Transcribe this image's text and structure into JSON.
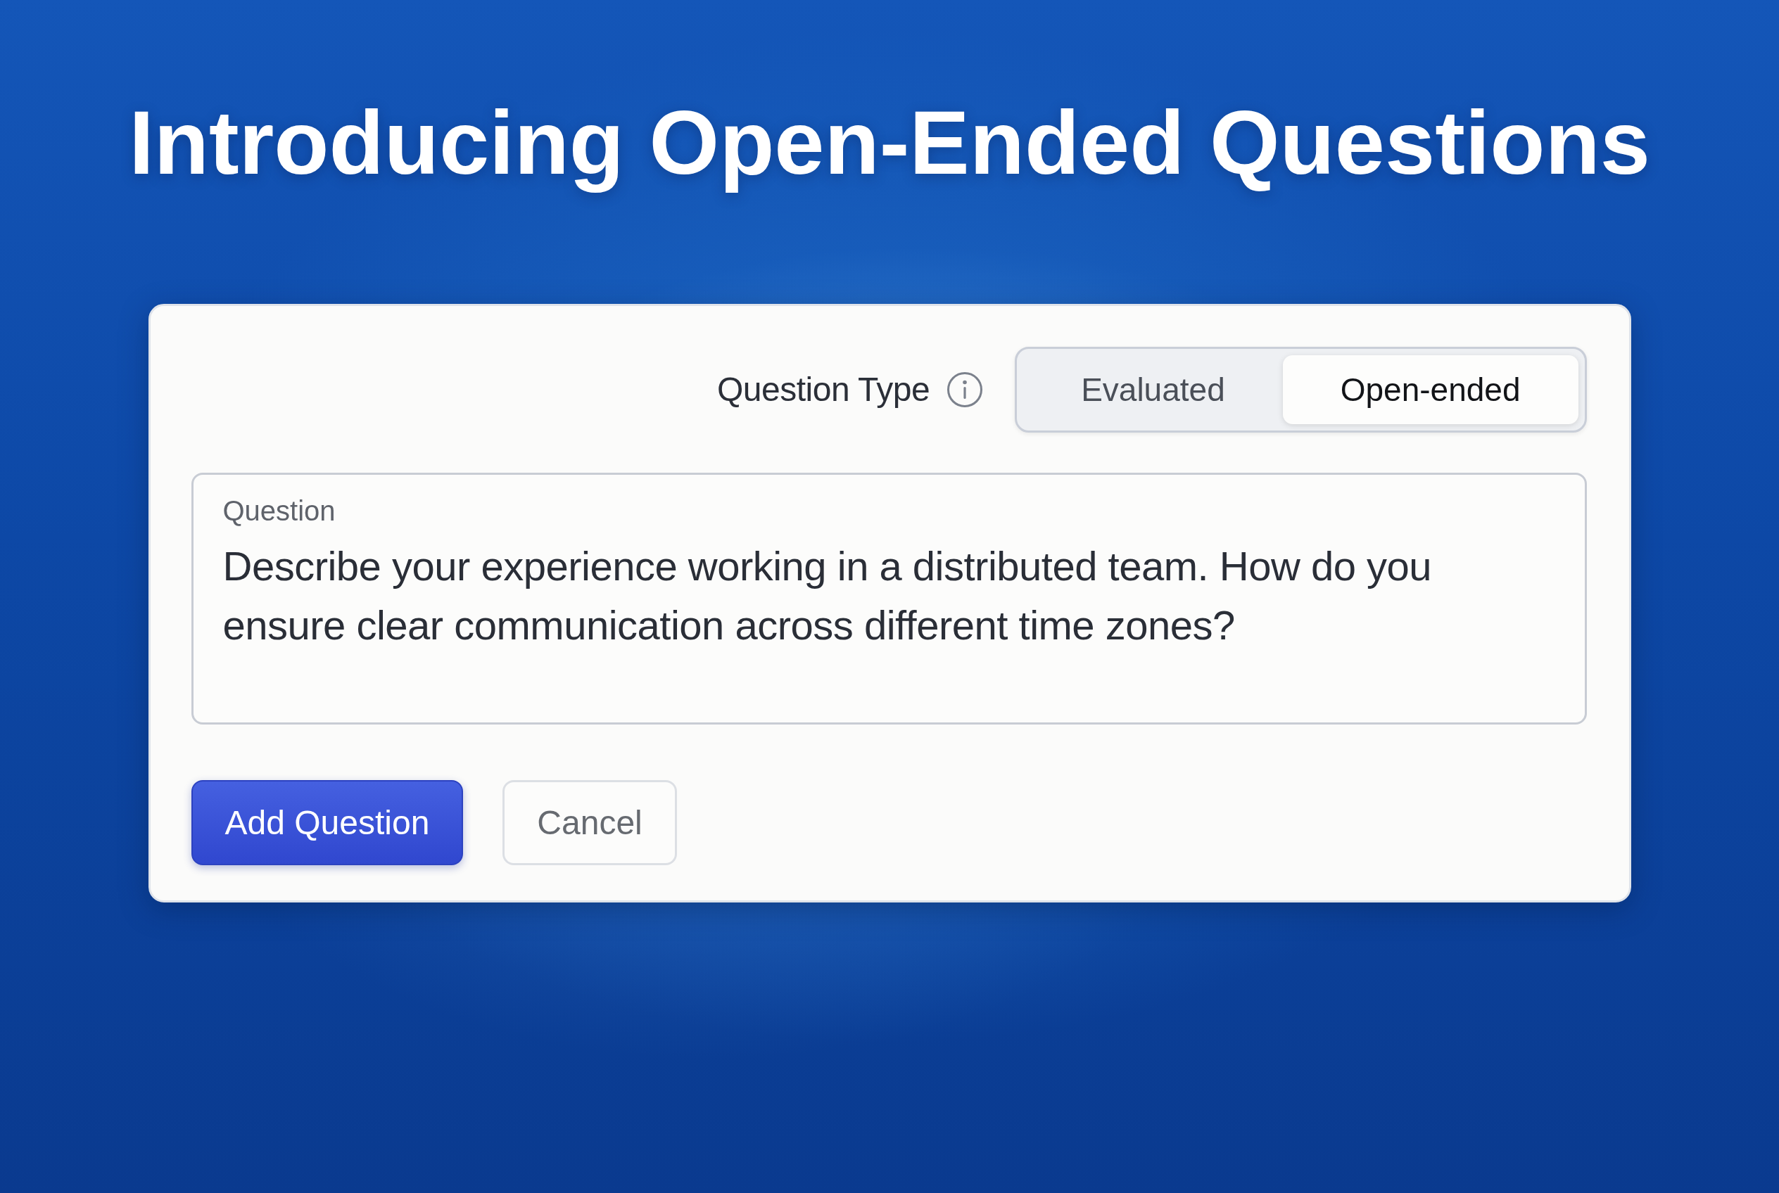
{
  "title": "Introducing Open-Ended Questions",
  "question_type": {
    "label": "Question Type",
    "options": [
      {
        "label": "Evaluated",
        "selected": false
      },
      {
        "label": "Open-ended",
        "selected": true
      }
    ]
  },
  "question_field": {
    "label": "Question",
    "value": "Describe your experience working in a distributed team. How do you ensure clear communication across different time zones?"
  },
  "buttons": [
    {
      "label": "Add Question",
      "kind": "primary"
    },
    {
      "label": "Cancel",
      "kind": "secondary"
    }
  ]
}
